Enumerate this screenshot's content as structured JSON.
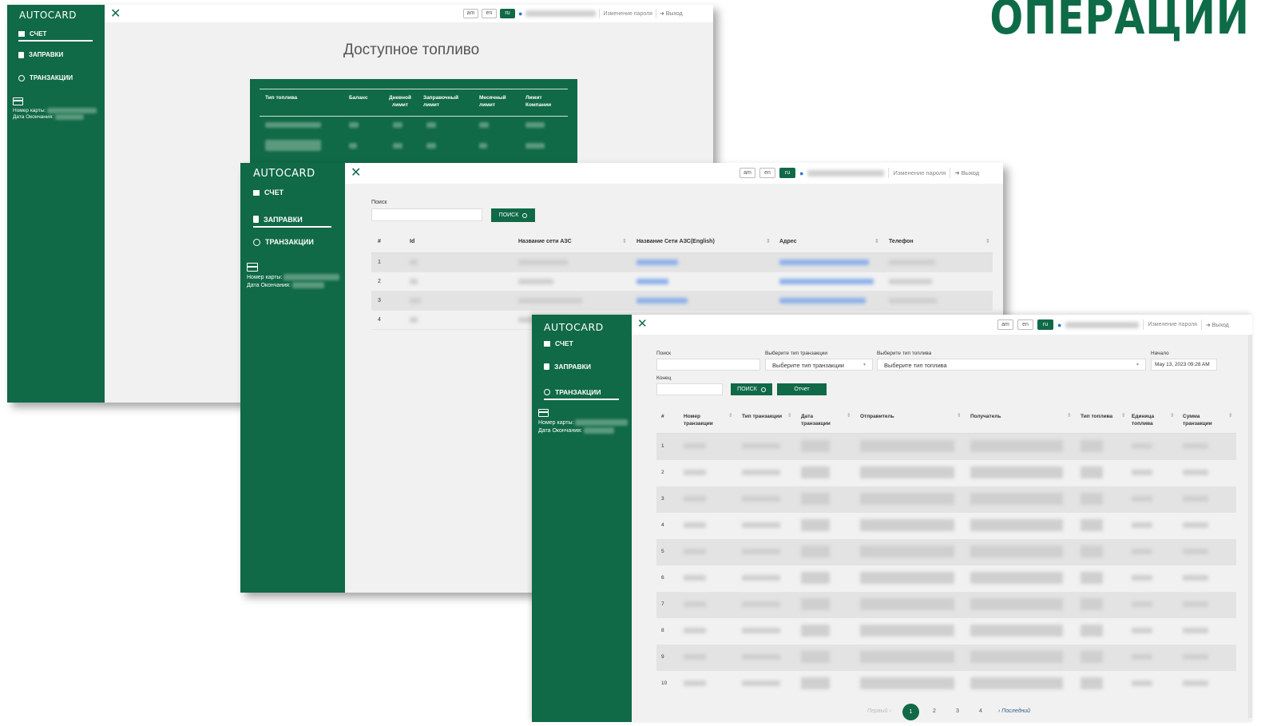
{
  "headline": "ОПЕРАЦИИ",
  "brand": {
    "logo": "AUTOCARD",
    "color": "#106947"
  },
  "header": {
    "langs": [
      "am",
      "en",
      "ru"
    ],
    "active_lang": "ru",
    "change_password": "Изменение пароля",
    "logout": "Выход"
  },
  "sidebar": {
    "items": [
      {
        "label": "СЧЕТ",
        "icon": "grid-icon"
      },
      {
        "label": "ЗАПРАВКИ",
        "icon": "fuel-pump-icon"
      },
      {
        "label": "ТРАНЗАКЦИИ",
        "icon": "clock-icon"
      }
    ],
    "card_number_label": "Номер карты:",
    "expiry_label": "Дата Окончания:"
  },
  "fuel_window": {
    "title": "Доступное топливо",
    "columns": [
      "Тип топлива",
      "Баланс",
      "Дневной лимит",
      "Заправочный лимит",
      "Месячный лимит",
      "Лимит Компании"
    ]
  },
  "stations_window": {
    "search_label": "Поиск",
    "search_button": "ПОИСК",
    "columns": [
      "#",
      "Id",
      "Название сети АЗС",
      "Название Сети АЗС(English)",
      "Адрес",
      "Телефон"
    ],
    "rows": [
      "1",
      "2",
      "3",
      "4"
    ]
  },
  "transactions_window": {
    "search_label": "Поиск",
    "tx_type_label": "Выберите тип транзакции",
    "tx_type_placeholder": "Выберите тип транзакции",
    "fuel_type_label": "Выберите тип топлива",
    "fuel_type_placeholder": "Выберите тип топлива",
    "start_label": "Начало",
    "start_value": "May 13, 2023 09:28 AM",
    "end_label": "Конец",
    "search_button": "ПОИСК",
    "report_button": "Отчет",
    "columns": [
      "#",
      "Номер транзакции",
      "Тип транзакции",
      "Дата транзакции",
      "Отправитель",
      "Получатель",
      "Тип топлива",
      "Единица топлива",
      "Сумма транзакции"
    ],
    "rows": [
      "1",
      "2",
      "3",
      "4",
      "5",
      "6",
      "7",
      "8",
      "9",
      "10"
    ],
    "pagination": {
      "first": "Первый",
      "pages": [
        "1",
        "2",
        "3",
        "4"
      ],
      "active_page": "1",
      "last": "Последний"
    }
  }
}
